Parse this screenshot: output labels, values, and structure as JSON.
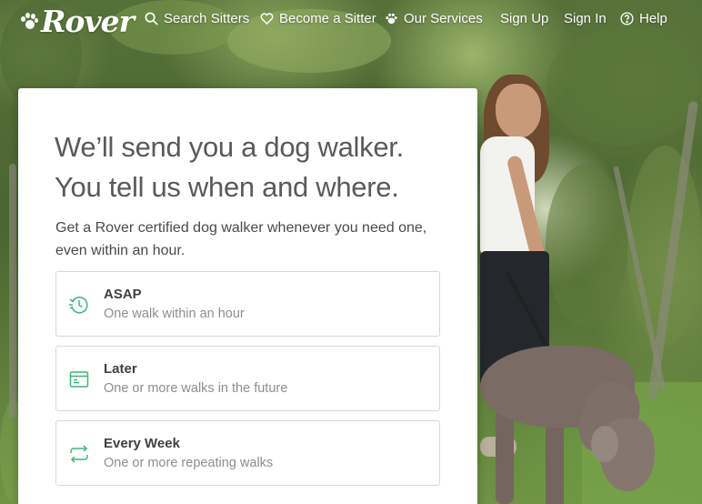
{
  "brand": {
    "name": "Rover"
  },
  "nav": {
    "items": [
      {
        "label": "Search Sitters",
        "icon": "search-icon"
      },
      {
        "label": "Become a Sitter",
        "icon": "heart-icon"
      },
      {
        "label": "Our Services",
        "icon": "paw-icon"
      },
      {
        "label": "Sign Up",
        "icon": ""
      },
      {
        "label": "Sign In",
        "icon": ""
      },
      {
        "label": "Help",
        "icon": "question-circle-icon"
      }
    ]
  },
  "hero": {
    "headline_line1": "We’ll send you a dog walker.",
    "headline_line2": "You tell us when and where.",
    "subtitle_line1": "Get a Rover certified dog walker whenever you need one,",
    "subtitle_line2": "even within an hour."
  },
  "options": [
    {
      "title": "ASAP",
      "description": "One walk within an hour",
      "icon": "clock-icon"
    },
    {
      "title": "Later",
      "description": "One or more walks in the future",
      "icon": "calendar-icon"
    },
    {
      "title": "Every Week",
      "description": "One or more repeating walks",
      "icon": "repeat-icon"
    }
  ],
  "colors": {
    "accent_green": "#3fb37f",
    "text_dark": "#404042",
    "text_muted": "#8e8e92",
    "border": "#d8d8dc"
  }
}
